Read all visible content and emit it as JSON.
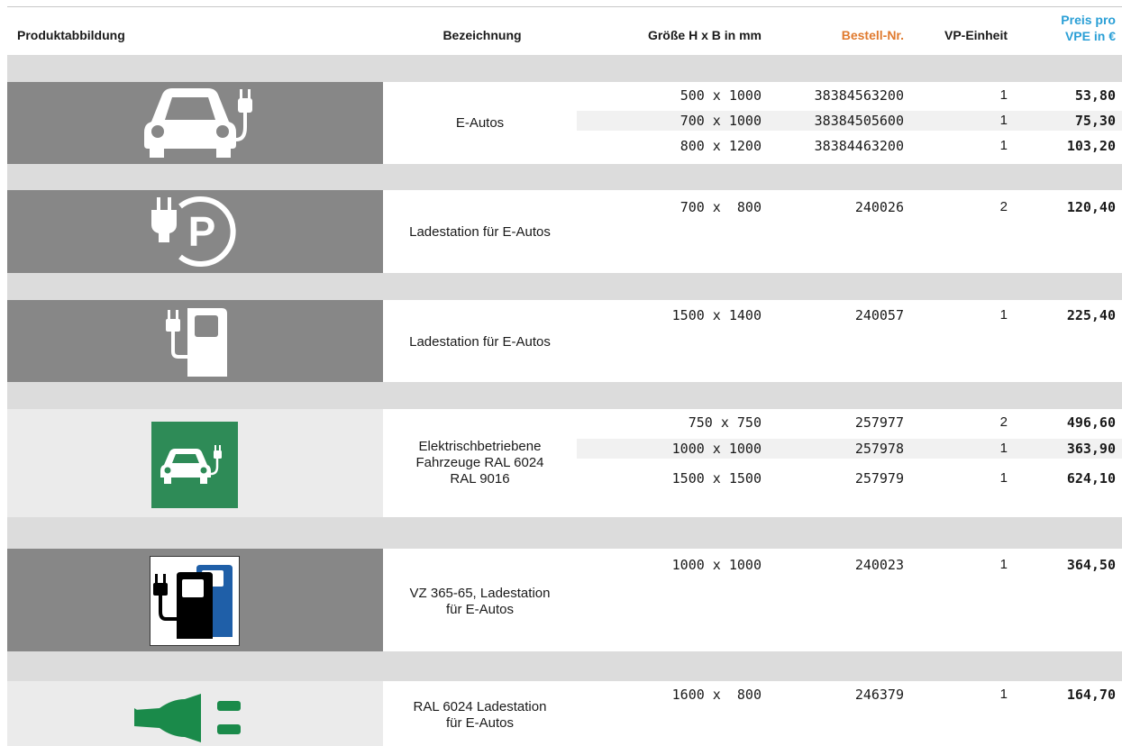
{
  "headers": {
    "image": "Produktabbildung",
    "name": "Bezeichnung",
    "size": "Größe H x B in mm",
    "order": "Bestell-Nr.",
    "vp": "VP-Einheit",
    "price_line1": "Preis pro",
    "price_line2": "VPE in €"
  },
  "colors": {
    "order_header": "#e07a2e",
    "price_header": "#2a9fd6",
    "sign_green": "#2e8b57",
    "plug_green": "#1a8a4a"
  },
  "products": [
    {
      "icon": "ev-car-icon",
      "name": "E-Autos",
      "rows": [
        {
          "size": "500 x 1000",
          "order": "38384563200",
          "vp": "1",
          "price": "53,80"
        },
        {
          "size": "700 x 1000",
          "order": "38384505600",
          "vp": "1",
          "price": "75,30"
        },
        {
          "size": "800 x 1200",
          "order": "38384463200",
          "vp": "1",
          "price": "103,20"
        }
      ]
    },
    {
      "icon": "plug-parking-icon",
      "name": "Ladestation für E-Autos",
      "rows": [
        {
          "size": "700 x  800",
          "order": "240026",
          "vp": "2",
          "price": "120,40"
        }
      ]
    },
    {
      "icon": "charging-station-icon",
      "name": "Ladestation für E-Autos",
      "rows": [
        {
          "size": "1500 x 1400",
          "order": "240057",
          "vp": "1",
          "price": "225,40"
        }
      ]
    },
    {
      "icon": "green-ev-sign-icon",
      "name_lines": [
        "Elektrischbetriebene",
        "Fahrzeuge RAL 6024",
        "RAL 9016"
      ],
      "rows": [
        {
          "size": "750 x 750",
          "order": "257977",
          "vp": "2",
          "price": "496,60"
        },
        {
          "size": "1000 x 1000",
          "order": "257978",
          "vp": "1",
          "price": "363,90"
        },
        {
          "size": "1500 x 1500",
          "order": "257979",
          "vp": "1",
          "price": "624,10"
        }
      ]
    },
    {
      "icon": "vz-365-65-sign-icon",
      "name_lines": [
        "VZ 365-65, Ladestation",
        "für E-Autos"
      ],
      "rows": [
        {
          "size": "1000 x 1000",
          "order": "240023",
          "vp": "1",
          "price": "364,50"
        }
      ]
    },
    {
      "icon": "green-plug-icon",
      "name_lines": [
        "RAL 6024 Ladestation",
        "für E-Autos"
      ],
      "rows": [
        {
          "size": "1600 x  800",
          "order": "246379",
          "vp": "1",
          "price": "164,70"
        }
      ]
    }
  ]
}
